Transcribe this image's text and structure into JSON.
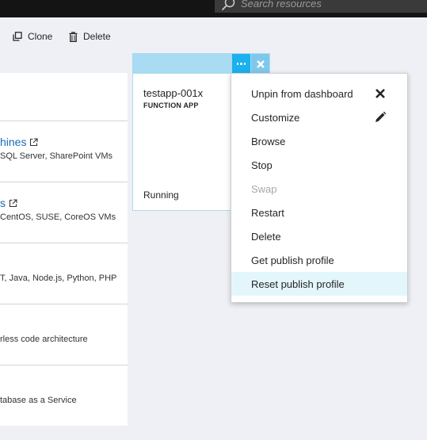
{
  "search": {
    "placeholder": "Search resources"
  },
  "toolbar": {
    "clone_label": "Clone",
    "delete_label": "Delete"
  },
  "left_panel": {
    "items": [
      {
        "title": "",
        "desc": ""
      },
      {
        "title": "hines",
        "desc": "SQL Server, SharePoint VMs"
      },
      {
        "title": "s",
        "desc": "CentOS, SUSE, CoreOS VMs"
      },
      {
        "title": "",
        "desc": "T, Java, Node.js, Python, PHP"
      },
      {
        "title": "",
        "desc": "rless code architecture"
      },
      {
        "title": "",
        "desc": "tabase as a Service"
      }
    ]
  },
  "tile": {
    "name": "testapp-001x",
    "type": "FUNCTION APP",
    "status": "Running"
  },
  "context_menu": {
    "items": [
      {
        "label": "Unpin from dashboard",
        "icon": "close-icon",
        "disabled": false
      },
      {
        "label": "Customize",
        "icon": "pencil-icon",
        "disabled": false
      },
      {
        "label": "Browse",
        "disabled": false
      },
      {
        "label": "Stop",
        "disabled": false
      },
      {
        "label": "Swap",
        "disabled": true
      },
      {
        "label": "Restart",
        "disabled": false
      },
      {
        "label": "Delete",
        "disabled": false
      },
      {
        "label": "Get publish profile",
        "disabled": false
      },
      {
        "label": "Reset publish profile",
        "disabled": false,
        "hovered": true
      }
    ]
  },
  "colors": {
    "accent": "#1bb0ee",
    "tile_header": "#a9dbf3",
    "link": "#1a6bb5",
    "menu_hover": "#e3f6fb",
    "topbar": "#141414"
  }
}
